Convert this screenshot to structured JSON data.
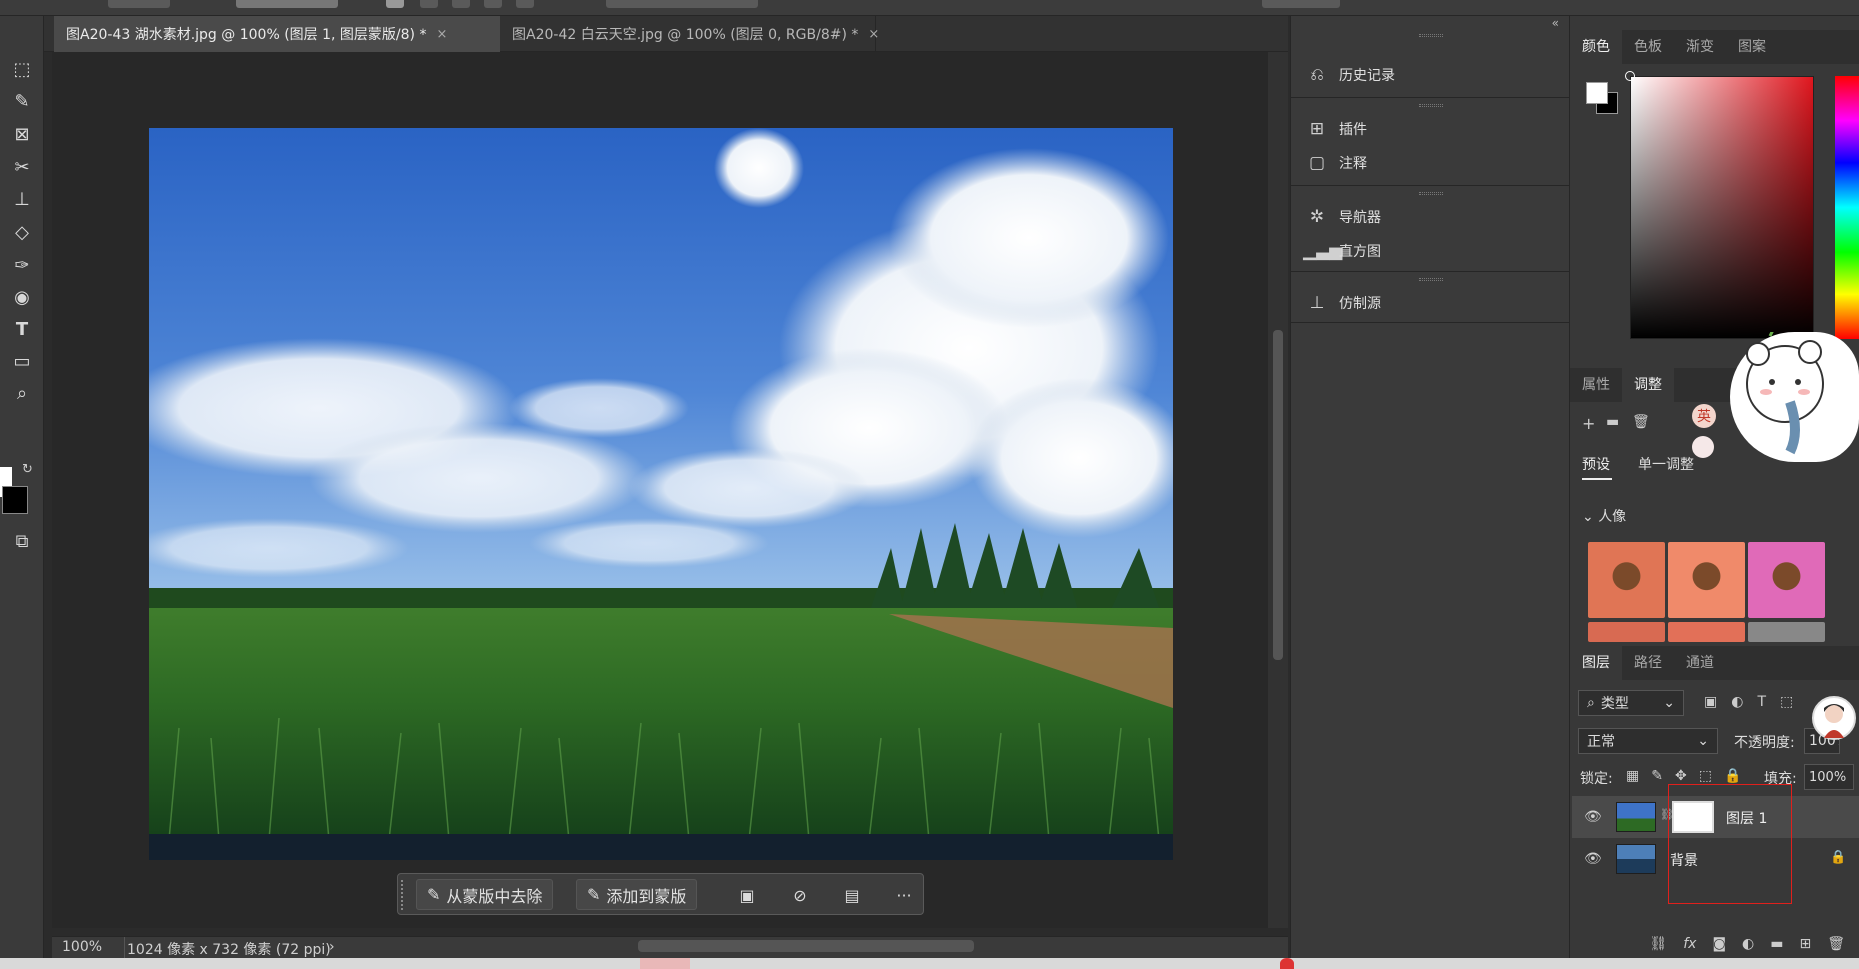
{
  "tabs": [
    {
      "label": "图A20-43 湖水素材.jpg @ 100% (图层 1, 图层蒙版/8) *",
      "close": "×"
    },
    {
      "label": "图A20-42 白云天空.jpg @ 100% (图层 0, RGB/8#) *",
      "close": "×"
    }
  ],
  "taskbar": {
    "remove_from_mask": "从蒙版中去除",
    "add_to_mask": "添加到蒙版",
    "more": "···"
  },
  "status": {
    "zoom": "100%",
    "doc_info": "1024 像素 x 732 像素 (72 ppi)",
    "arrow": "›"
  },
  "panel_collapse": "«",
  "panel_history_group": [
    {
      "label": "历史记录",
      "icon": "history-icon"
    }
  ],
  "panel_plugins_group": [
    {
      "label": "插件",
      "icon": "plugin-icon"
    },
    {
      "label": "注释",
      "icon": "comment-icon"
    }
  ],
  "panel_navigator_group": [
    {
      "label": "导航器",
      "icon": "navigator-icon"
    },
    {
      "label": "直方图",
      "icon": "histogram-icon"
    }
  ],
  "panel_clone_group": [
    {
      "label": "仿制源",
      "icon": "clone-source-icon"
    }
  ],
  "color_tabs": [
    "颜色",
    "色板",
    "渐变",
    "图案"
  ],
  "adjust_tabs": [
    "属性",
    "调整"
  ],
  "adjust_subtabs": [
    "预设",
    "单一调整"
  ],
  "adjust_section": "人像",
  "layers_tabs": [
    "图层",
    "路径",
    "通道"
  ],
  "layers": {
    "filter_kind": "类型",
    "blend_mode": "正常",
    "opacity_label": "不透明度:",
    "opacity_value": "100%",
    "lock_label": "锁定:",
    "fill_label": "填充:",
    "fill_value": "100%",
    "items": [
      {
        "name": "图层 1"
      },
      {
        "name": "背景"
      }
    ]
  },
  "sticker_text": "英",
  "colors": {
    "accent_red": "#e0201c",
    "panel_bg": "#383838",
    "canvas_bg": "#282828"
  }
}
